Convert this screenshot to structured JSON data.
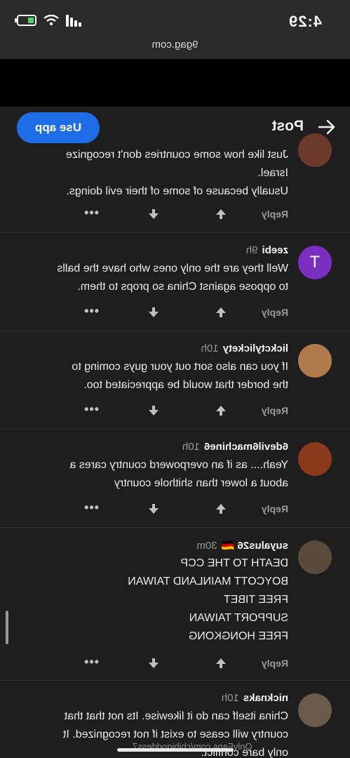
{
  "status": {
    "time": "4:29"
  },
  "browser": {
    "url": "9gag.com"
  },
  "header": {
    "title": "Post",
    "use_app": "Use app"
  },
  "comments": [
    {
      "username": "",
      "age": "",
      "lines": [
        "Just like how some countries don't recognize",
        "Israel.",
        "Usually because of some of their evil doings."
      ],
      "reply": "Reply",
      "avatar_color": "#6b3a2a"
    },
    {
      "username": "zeebi",
      "age": "9h",
      "lines": [
        "Well they are the only ones who have the balls",
        "to oppose against China so props to them."
      ],
      "reply": "Reply",
      "avatar_color": "#7b2fc0",
      "avatar_letter": "T"
    },
    {
      "username": "lickctylickety",
      "age": "10h",
      "lines": [
        "If you can also sort out your guys coming to",
        "the border that would be appreciated too."
      ],
      "reply": "Reply",
      "avatar_color": "#b07a4a"
    },
    {
      "username": "6devil6machine6",
      "age": "10h",
      "lines": [
        "Yeah.... as if an overpowerd country cares a",
        "about a lower than shithole country"
      ],
      "reply": "Reply",
      "avatar_color": "#8a3a1a"
    },
    {
      "username": "suyalus26",
      "flag": "🇩🇪",
      "age": "30m",
      "lines": [
        "DEATH TO THE CCP",
        "BOYCOTT MAINLAND TAIWAN",
        "FREE TIBET",
        "SUPPORT TAIWAN",
        "FREE HONGKONG"
      ],
      "reply": "Reply",
      "avatar_color": "#5a4a3a"
    },
    {
      "username": "nicknaks",
      "age": "10h",
      "lines": [
        "China itself can do it likewise. Its not that that",
        "country will cease to exist if not recognized. It",
        "only bare conflict."
      ],
      "reply": "Reply",
      "avatar_color": "#6a5a4a"
    }
  ],
  "watermark": "OnlyFans.com/chibigoddess7"
}
